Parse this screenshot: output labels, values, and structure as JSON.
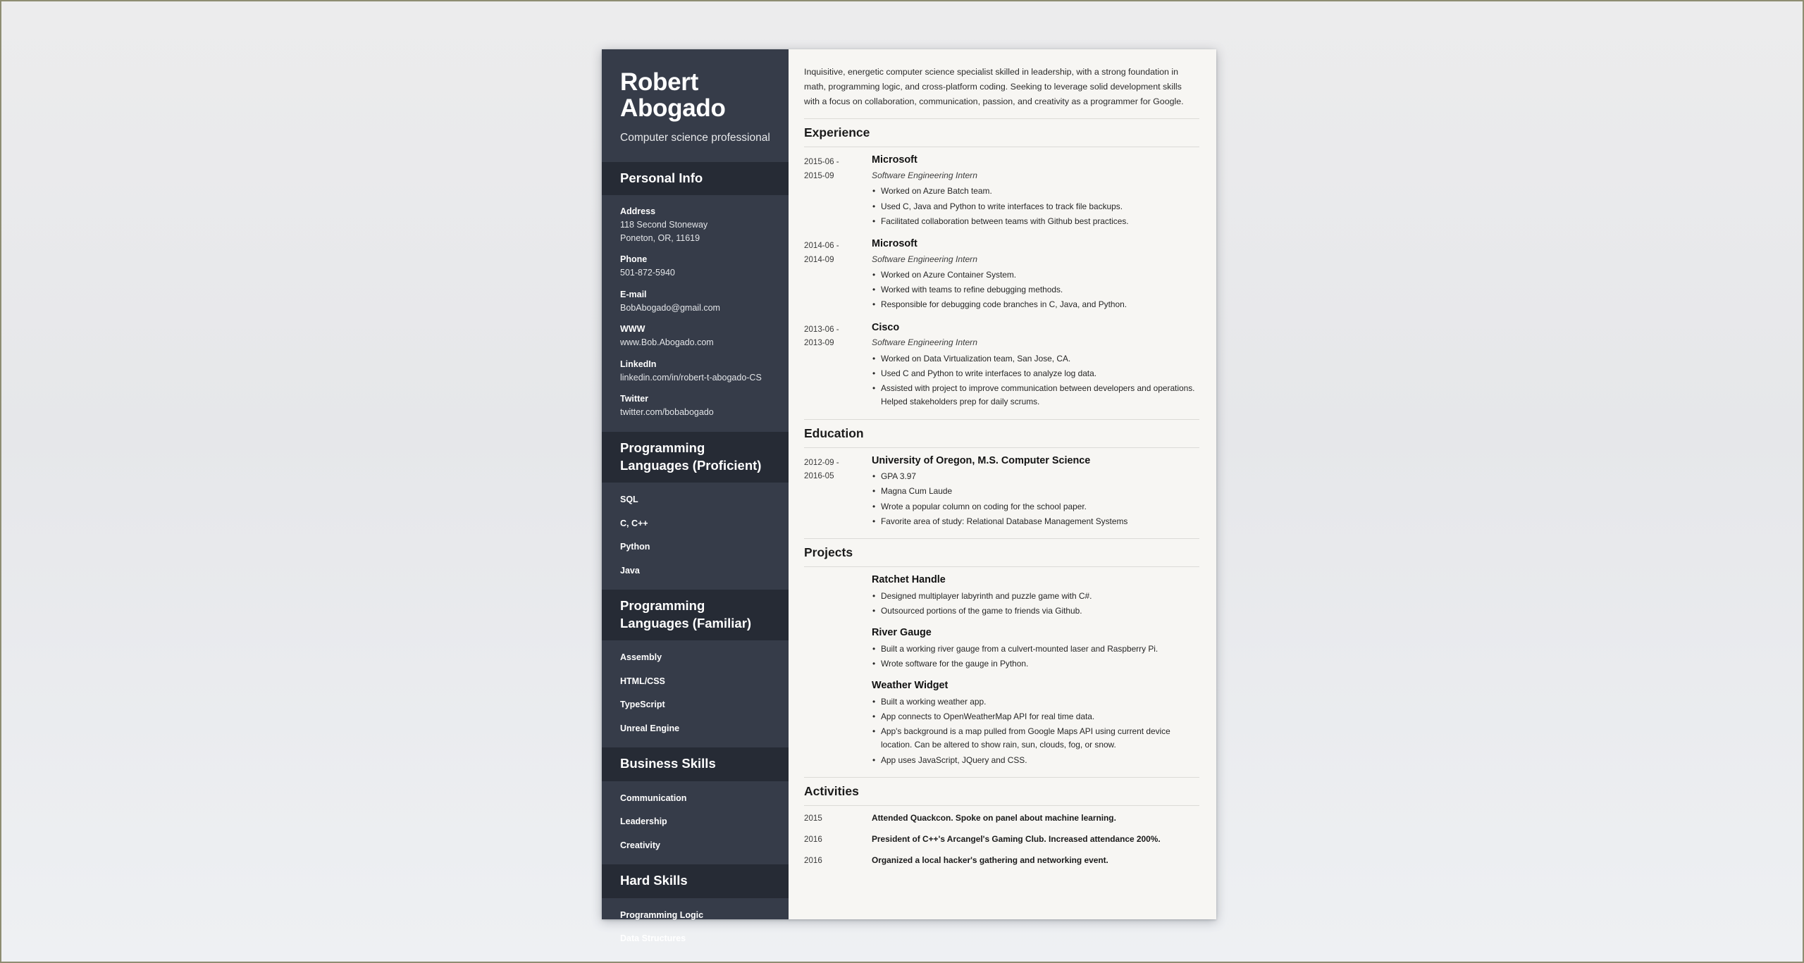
{
  "document": {
    "sidebar_bg": "#363c49",
    "sidebar_header_bg": "#262b35",
    "paper_bg": "#f7f6f3"
  },
  "header": {
    "name": "Robert Abogado",
    "tagline": "Computer science professional"
  },
  "summary": "Inquisitive, energetic computer science specialist skilled in leadership, with a strong foundation in math, programming logic, and cross-platform coding. Seeking to leverage solid development skills with a focus on collaboration, communication, passion, and creativity as a programmer for Google.",
  "sidebar": {
    "personal_info": {
      "heading": "Personal Info",
      "fields": [
        {
          "label": "Address",
          "line1": "118 Second Stoneway",
          "line2": "Poneton, OR, 11619"
        },
        {
          "label": "Phone",
          "line1": "501-872-5940",
          "line2": ""
        },
        {
          "label": "E-mail",
          "line1": "BobAbogado@gmail.com",
          "line2": ""
        },
        {
          "label": "WWW",
          "line1": "www.Bob.Abogado.com",
          "line2": ""
        },
        {
          "label": "LinkedIn",
          "line1": "linkedin.com/in/robert-t-abogado-CS",
          "line2": ""
        },
        {
          "label": "Twitter",
          "line1": "twitter.com/bobabogado",
          "line2": ""
        }
      ]
    },
    "languages_proficient": {
      "heading": "Programming Languages (Proficient)",
      "items": [
        "SQL",
        "C, C++",
        "Python",
        "Java"
      ]
    },
    "languages_familiar": {
      "heading": "Programming Languages (Familiar)",
      "items": [
        "Assembly",
        "HTML/CSS",
        "TypeScript",
        "Unreal Engine"
      ]
    },
    "business_skills": {
      "heading": "Business Skills",
      "items": [
        "Communication",
        "Leadership",
        "Creativity"
      ]
    },
    "hard_skills": {
      "heading": "Hard Skills",
      "items": [
        "Programming Logic",
        "Data Structures"
      ]
    }
  },
  "experience": {
    "heading": "Experience",
    "entries": [
      {
        "date_start": "2015-06 -",
        "date_end": "2015-09",
        "organization": "Microsoft",
        "role": "Software Engineering Intern",
        "bullets": [
          "Worked on Azure Batch team.",
          "Used C, Java and Python to write interfaces to track file backups.",
          "Facilitated collaboration between teams with Github best practices."
        ]
      },
      {
        "date_start": "2014-06 -",
        "date_end": "2014-09",
        "organization": "Microsoft",
        "role": "Software Engineering Intern",
        "bullets": [
          "Worked on Azure Container System.",
          "Worked with teams to refine debugging methods.",
          "Responsible for debugging code branches in C, Java, and Python."
        ]
      },
      {
        "date_start": "2013-06 -",
        "date_end": "2013-09",
        "organization": "Cisco",
        "role": "Software Engineering Intern",
        "bullets": [
          "Worked on Data Virtualization team, San Jose, CA.",
          "Used C and Python to write interfaces to analyze log data.",
          "Assisted with project to improve communication between developers and operations. Helped stakeholders prep for daily scrums."
        ]
      }
    ]
  },
  "education": {
    "heading": "Education",
    "entries": [
      {
        "date_start": "2012-09 -",
        "date_end": "2016-05",
        "institution": "University of Oregon, M.S. Computer Science",
        "bullets": [
          "GPA 3.97",
          "Magna Cum Laude",
          "Wrote a popular column on coding for the school paper.",
          "Favorite area of study: Relational Database Management Systems"
        ]
      }
    ]
  },
  "projects": {
    "heading": "Projects",
    "entries": [
      {
        "name": "Ratchet Handle",
        "bullets": [
          "Designed multiplayer labyrinth and puzzle game with C#.",
          "Outsourced portions of the game to friends via Github."
        ]
      },
      {
        "name": "River Gauge",
        "bullets": [
          "Built a working river gauge from a culvert-mounted laser and Raspberry Pi.",
          "Wrote software for the gauge in Python."
        ]
      },
      {
        "name": "Weather Widget",
        "bullets": [
          "Built a working weather app.",
          "App connects to OpenWeatherMap API for real time data.",
          "App's background is a map pulled from Google Maps API using current device location. Can be altered to show rain, sun, clouds, fog, or snow.",
          "App uses JavaScript, JQuery and CSS."
        ]
      }
    ]
  },
  "activities": {
    "heading": "Activities",
    "entries": [
      {
        "year": "2015",
        "text": "Attended Quackcon. Spoke on panel about machine learning."
      },
      {
        "year": "2016",
        "text": "President of C++'s Arcangel's Gaming Club. Increased attendance 200%."
      },
      {
        "year": "2016",
        "text": "Organized a local hacker's gathering and networking event."
      }
    ]
  }
}
